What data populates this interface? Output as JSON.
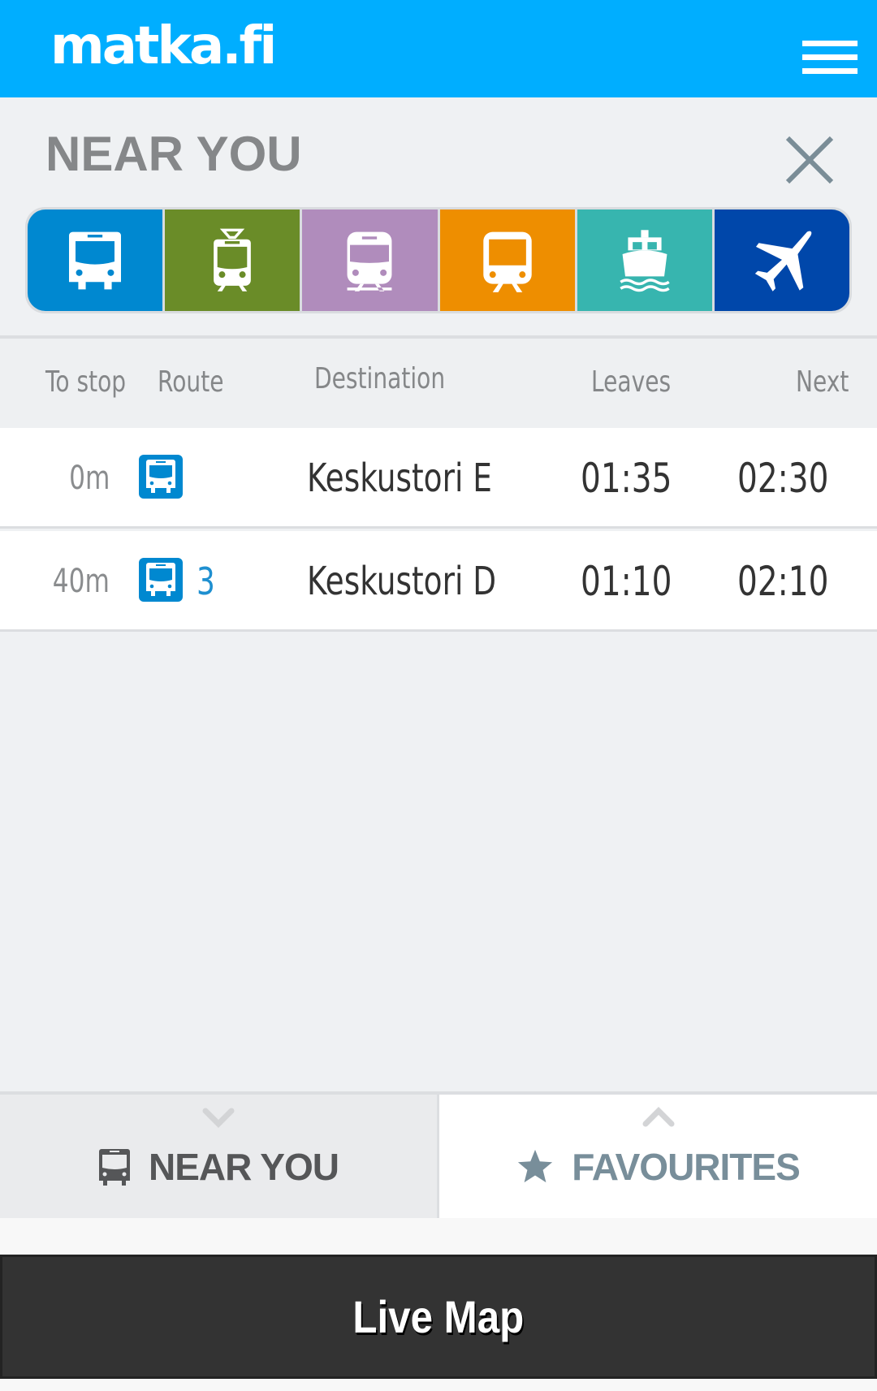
{
  "header": {
    "logo_text": "matka.fi",
    "menu_icon": "hamburger-menu-icon"
  },
  "panel": {
    "title": "NEAR YOU",
    "close_icon": "close-icon"
  },
  "modes": [
    {
      "name": "bus",
      "icon": "bus-icon",
      "color": "#0088D0"
    },
    {
      "name": "tram",
      "icon": "tram-icon",
      "color": "#6A8C28"
    },
    {
      "name": "train",
      "icon": "train-icon",
      "color": "#B08CBC"
    },
    {
      "name": "metro",
      "icon": "metro-icon",
      "color": "#EE8E00"
    },
    {
      "name": "ferry",
      "icon": "ferry-icon",
      "color": "#37B5AF"
    },
    {
      "name": "airplane",
      "icon": "airplane-icon",
      "color": "#0047AA"
    }
  ],
  "table": {
    "columns": [
      "To stop",
      "Route",
      "Destination",
      "Leaves",
      "Next"
    ],
    "rows": [
      {
        "to_stop": "0m",
        "route_icon": "bus-icon",
        "route": "",
        "destination": "Keskustori E",
        "leaves": "01:35",
        "next": "02:30"
      },
      {
        "to_stop": "40m",
        "route_icon": "bus-icon",
        "route": "3",
        "destination": "Keskustori D",
        "leaves": "01:10",
        "next": "02:10"
      }
    ]
  },
  "bottom_tabs": {
    "near_you": {
      "label": "NEAR YOU",
      "icon": "bus-icon",
      "chevron": "chevron-down-icon",
      "active": true
    },
    "favourites": {
      "label": "FAVOURITES",
      "icon": "star-icon",
      "chevron": "chevron-up-icon",
      "active": false
    }
  },
  "live_map": {
    "label": "Live Map"
  },
  "colors": {
    "header": "#00AEFF",
    "route_blue": "#0088D0",
    "live_map_bg": "#333333"
  }
}
